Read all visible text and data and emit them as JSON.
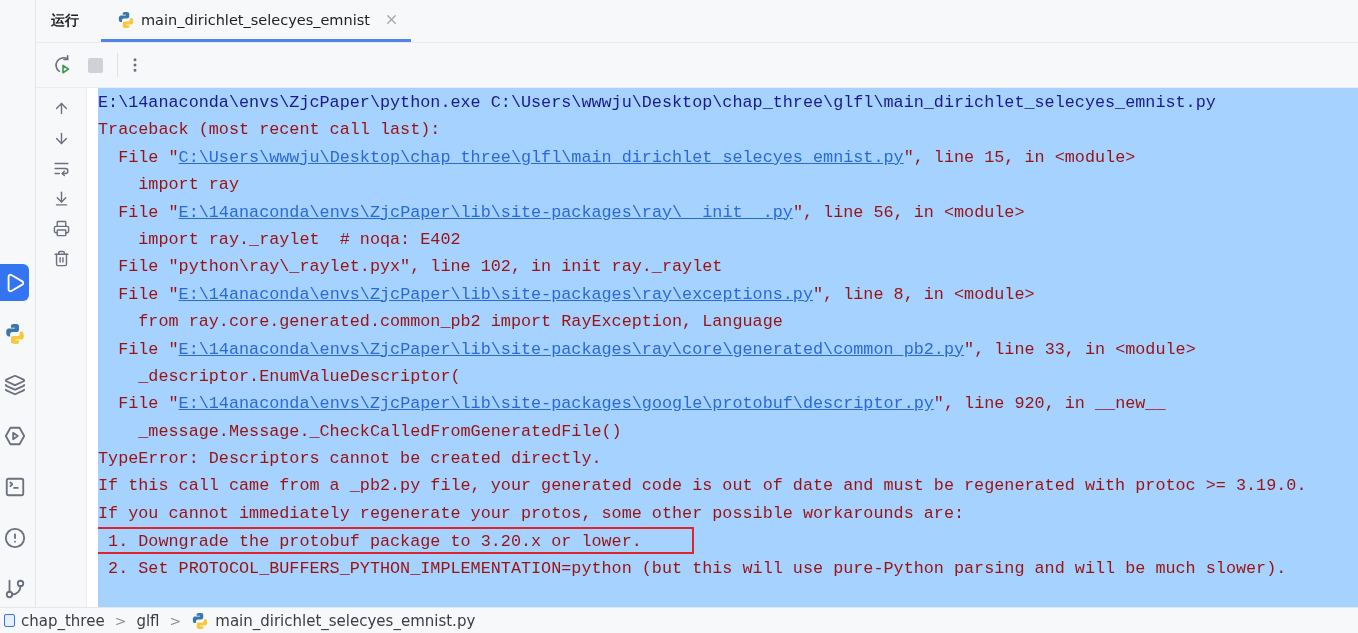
{
  "panel_title": "运行",
  "tabs": [
    {
      "label": "main_dirichlet_selecyes_emnist",
      "selected": true
    }
  ],
  "toolbar": {
    "stop_disabled": true
  },
  "activity_bar": [
    {
      "kind": "run",
      "selected": true
    },
    {
      "kind": "python",
      "selected": false
    },
    {
      "kind": "layers",
      "selected": false
    },
    {
      "kind": "services",
      "selected": false
    },
    {
      "kind": "terminal",
      "selected": false
    },
    {
      "kind": "problems",
      "selected": false
    },
    {
      "kind": "git",
      "selected": false
    }
  ],
  "console_tools": [
    {
      "kind": "up"
    },
    {
      "kind": "down"
    },
    {
      "kind": "wrap"
    },
    {
      "kind": "scroll"
    },
    {
      "kind": "print"
    },
    {
      "kind": "clear"
    }
  ],
  "console": {
    "selected": true,
    "lines": [
      {
        "kind": "command",
        "boxed": false,
        "segments": [
          {
            "kind": "text",
            "text": "E:\\14anaconda\\envs\\ZjcPaper\\python.exe C:\\Users\\wwwju\\Desktop\\chap_three\\glfl\\main_dirichlet_selecyes_emnist.py"
          }
        ]
      },
      {
        "kind": "error",
        "boxed": false,
        "segments": [
          {
            "kind": "text",
            "text": "Traceback (most recent call last):"
          }
        ]
      },
      {
        "kind": "error",
        "boxed": false,
        "segments": [
          {
            "kind": "text",
            "text": "  File \""
          },
          {
            "kind": "link",
            "text": "C:\\Users\\wwwju\\Desktop\\chap_three\\glfl\\main_dirichlet_selecyes_emnist.py"
          },
          {
            "kind": "text",
            "text": "\", line 15, in <module>"
          }
        ]
      },
      {
        "kind": "error",
        "boxed": false,
        "segments": [
          {
            "kind": "text",
            "text": "    import ray"
          }
        ]
      },
      {
        "kind": "error",
        "boxed": false,
        "segments": [
          {
            "kind": "text",
            "text": "  File \""
          },
          {
            "kind": "link",
            "text": "E:\\14anaconda\\envs\\ZjcPaper\\lib\\site-packages\\ray\\__init__.py"
          },
          {
            "kind": "text",
            "text": "\", line 56, in <module>"
          }
        ]
      },
      {
        "kind": "error",
        "boxed": false,
        "segments": [
          {
            "kind": "text",
            "text": "    import ray._raylet  # noqa: E402"
          }
        ]
      },
      {
        "kind": "error",
        "boxed": false,
        "segments": [
          {
            "kind": "text",
            "text": "  File \"python\\ray\\_raylet.pyx\", line 102, in init ray._raylet"
          }
        ]
      },
      {
        "kind": "error",
        "boxed": false,
        "segments": [
          {
            "kind": "text",
            "text": "  File \""
          },
          {
            "kind": "link",
            "text": "E:\\14anaconda\\envs\\ZjcPaper\\lib\\site-packages\\ray\\exceptions.py"
          },
          {
            "kind": "text",
            "text": "\", line 8, in <module>"
          }
        ]
      },
      {
        "kind": "error",
        "boxed": false,
        "segments": [
          {
            "kind": "text",
            "text": "    from ray.core.generated.common_pb2 import RayException, Language"
          }
        ]
      },
      {
        "kind": "error",
        "boxed": false,
        "segments": [
          {
            "kind": "text",
            "text": "  File \""
          },
          {
            "kind": "link",
            "text": "E:\\14anaconda\\envs\\ZjcPaper\\lib\\site-packages\\ray\\core\\generated\\common_pb2.py"
          },
          {
            "kind": "text",
            "text": "\", line 33, in <module>"
          }
        ]
      },
      {
        "kind": "error",
        "boxed": false,
        "segments": [
          {
            "kind": "text",
            "text": "    _descriptor.EnumValueDescriptor("
          }
        ]
      },
      {
        "kind": "error",
        "boxed": false,
        "segments": [
          {
            "kind": "text",
            "text": "  File \""
          },
          {
            "kind": "link",
            "text": "E:\\14anaconda\\envs\\ZjcPaper\\lib\\site-packages\\google\\protobuf\\descriptor.py"
          },
          {
            "kind": "text",
            "text": "\", line 920, in __new__"
          }
        ]
      },
      {
        "kind": "error",
        "boxed": false,
        "segments": [
          {
            "kind": "text",
            "text": "    _message.Message._CheckCalledFromGeneratedFile()"
          }
        ]
      },
      {
        "kind": "error",
        "boxed": false,
        "segments": [
          {
            "kind": "text",
            "text": "TypeError: Descriptors cannot be created directly."
          }
        ]
      },
      {
        "kind": "error",
        "boxed": false,
        "segments": [
          {
            "kind": "text",
            "text": "If this call came from a _pb2.py file, your generated code is out of date and must be regenerated with protoc >= 3.19.0."
          }
        ]
      },
      {
        "kind": "error",
        "boxed": false,
        "segments": [
          {
            "kind": "text",
            "text": "If you cannot immediately regenerate your protos, some other possible workarounds are:"
          }
        ]
      },
      {
        "kind": "error",
        "boxed": true,
        "segments": [
          {
            "kind": "text",
            "text": " 1. Downgrade the protobuf package to 3.20.x or lower."
          }
        ]
      },
      {
        "kind": "error",
        "boxed": false,
        "segments": [
          {
            "kind": "text",
            "text": " 2. Set PROTOCOL_BUFFERS_PYTHON_IMPLEMENTATION=python (but this will use pure-Python parsing and will be much slower)."
          }
        ]
      }
    ]
  },
  "breadcrumb": [
    {
      "kind": "folder",
      "text": "chap_three"
    },
    {
      "kind": "separator",
      "text": ">"
    },
    {
      "kind": "folder",
      "text": "glfl"
    },
    {
      "kind": "separator",
      "text": ">"
    },
    {
      "kind": "python",
      "text": "main_dirichlet_selecyes_emnist.py"
    }
  ]
}
